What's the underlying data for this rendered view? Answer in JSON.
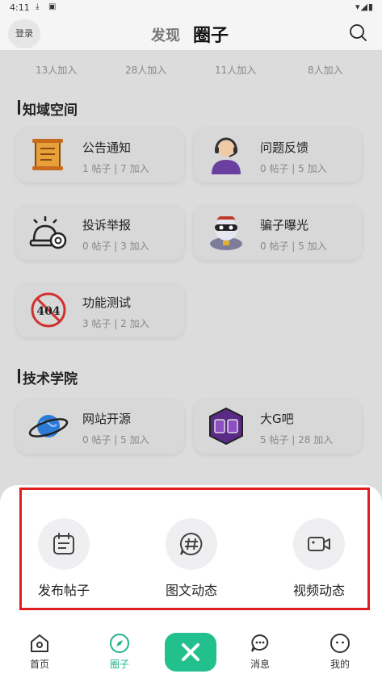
{
  "status": {
    "time": "4:11"
  },
  "header": {
    "login": "登录",
    "tab_discover": "发现",
    "tab_circle": "圈子"
  },
  "cut_row": {
    "counts": [
      "13人加入",
      "28人加入",
      "11人加入",
      "8人加入"
    ]
  },
  "sections": [
    {
      "title": "知域空间",
      "cards": [
        {
          "name": "公告通知",
          "meta": "1 帖子 | 7 加入",
          "icon": "scroll-icon"
        },
        {
          "name": "问题反馈",
          "meta": "0 帖子 | 5 加入",
          "icon": "support-agent-icon"
        },
        {
          "name": "投诉举报",
          "meta": "0 帖子 | 3 加入",
          "icon": "alarm-camera-icon"
        },
        {
          "name": "骗子曝光",
          "meta": "0 帖子 | 5 加入",
          "icon": "thief-mascot-icon"
        },
        {
          "name": "功能测试",
          "meta": "3 帖子 | 2 加入",
          "icon": "no-404-icon"
        }
      ]
    },
    {
      "title": "技术学院",
      "cards": [
        {
          "name": "网站开源",
          "meta": "0 帖子 | 5 加入",
          "icon": "planet-icon"
        },
        {
          "name": "大G吧",
          "meta": "5 帖子 | 28 加入",
          "icon": "gg-logo-icon"
        }
      ]
    }
  ],
  "sheet": {
    "actions": [
      {
        "label": "发布帖子",
        "icon": "calendar-note-icon"
      },
      {
        "label": "图文动态",
        "icon": "hashtag-bubble-icon"
      },
      {
        "label": "视频动态",
        "icon": "video-camera-icon"
      }
    ]
  },
  "nav": {
    "items": [
      {
        "label": "首页",
        "icon": "home-icon"
      },
      {
        "label": "圈子",
        "icon": "compass-icon"
      },
      {
        "label": "消息",
        "icon": "chat-bubble-icon"
      },
      {
        "label": "我的",
        "icon": "profile-face-icon"
      }
    ]
  },
  "colors": {
    "accent": "#22c08c",
    "highlight_box": "#e02020",
    "background": "#dcdcdc"
  }
}
